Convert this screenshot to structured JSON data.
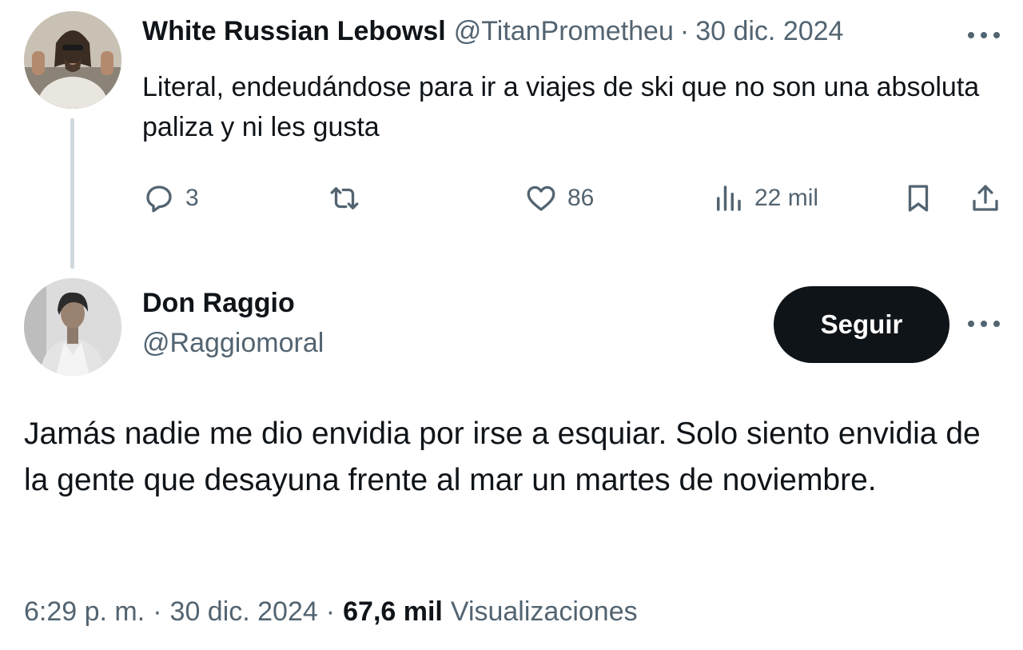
{
  "parent_tweet": {
    "author_name": "White Russian Lebowsl",
    "handle": "@TitanPrometheu",
    "separator": "·",
    "date": "30 dic. 2024",
    "text": "Literal, endeudándose para ir a viajes de ski que no son una absoluta paliza y ni les gusta",
    "actions": {
      "replies": "3",
      "likes": "86",
      "views": "22 mil"
    }
  },
  "main_tweet": {
    "author_name": "Don Raggio",
    "handle": "@Raggiomoral",
    "follow_label": "Seguir",
    "text": "Jamás nadie me dio envidia por irse a esquiar. Solo siento envidia de la gente que desayuna frente al mar un martes de noviembre.",
    "time": "6:29 p. m.",
    "date": "30 dic. 2024",
    "separator": "·",
    "views_count": "67,6 mil",
    "views_label": "Visualizaciones"
  },
  "icons": {
    "reply": "reply-icon",
    "retweet": "retweet-icon",
    "like": "heart-icon",
    "views": "views-icon",
    "bookmark": "bookmark-icon",
    "share": "share-icon",
    "more": "more-icon"
  },
  "colors": {
    "text_primary": "#0f1419",
    "text_secondary": "#536471",
    "thread_line": "#cfd9de",
    "follow_button_bg": "#0f1419"
  }
}
